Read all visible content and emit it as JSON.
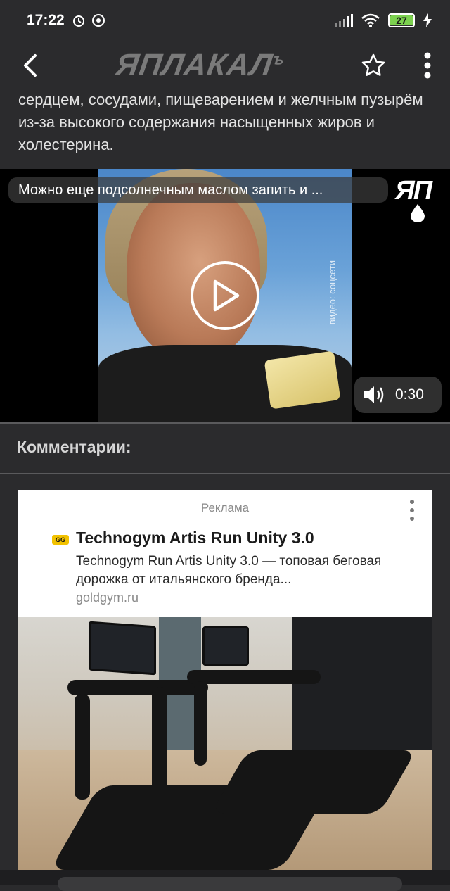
{
  "status_bar": {
    "time": "17:22",
    "battery": "27",
    "icons": [
      "alarm-icon",
      "shield-icon",
      "signal-icon",
      "wifi-icon",
      "battery-icon",
      "charging-icon"
    ]
  },
  "header": {
    "logo_text": "ЯПЛАКАЛ",
    "logo_suffix": "ъ",
    "back_icon": "back-arrow-icon",
    "favorite_icon": "star-icon",
    "menu_icon": "more-vertical-icon"
  },
  "article": {
    "text": "сердцем, сосудами, пищеварением и желчным пузырём из-за высокого содержания насыщенных жиров и холестерина."
  },
  "video": {
    "title": "Можно еще подсолнечным маслом запить и ...",
    "channel_logo": "ЯП",
    "watermark": "видео: соцсети",
    "duration": "0:30",
    "volume_icon": "volume-icon",
    "play_icon": "play-icon"
  },
  "comments": {
    "title": "Комментарии:"
  },
  "ad": {
    "label": "Реклама",
    "brand_badge": "GG",
    "title": "Technogym Artis Run Unity 3.0",
    "description": "Technogym Run Artis Unity 3.0 — топовая беговая дорожка от итальянского бренда...",
    "domain": "goldgym.ru"
  }
}
